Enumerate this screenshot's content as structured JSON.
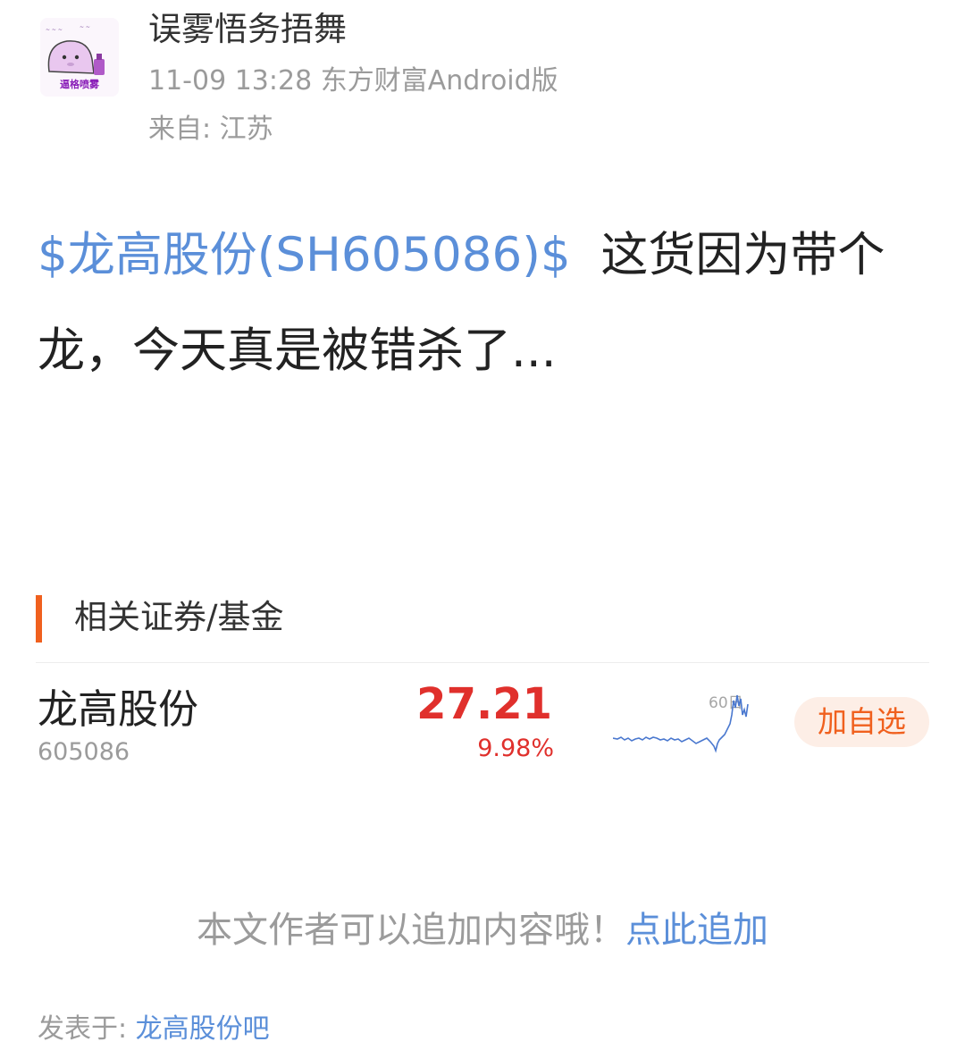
{
  "author": {
    "name": "误雾悟务捂舞",
    "avatar_text": "逼格喷雾",
    "meta": "11-09 13:28 东方财富Android版",
    "location": "来自: 江苏"
  },
  "post": {
    "stock_tag": "$龙高股份(SH605086)$",
    "text": "这货因为带个龙，今天真是被错杀了..."
  },
  "related": {
    "section_title": "相关证券/基金",
    "stock": {
      "name": "龙高股份",
      "code": "605086",
      "price": "27.21",
      "change": "9.98%",
      "chart_label": "60日",
      "add_label": "加自选",
      "color_up": "#e0302c"
    }
  },
  "append": {
    "hint": "本文作者可以追加内容哦！",
    "link": "点此追加"
  },
  "footer": {
    "label": "发表于: ",
    "forum": "龙高股份吧"
  },
  "colors": {
    "link": "#5b8fd9",
    "accent": "#f0601e",
    "muted": "#9b9b9b"
  }
}
